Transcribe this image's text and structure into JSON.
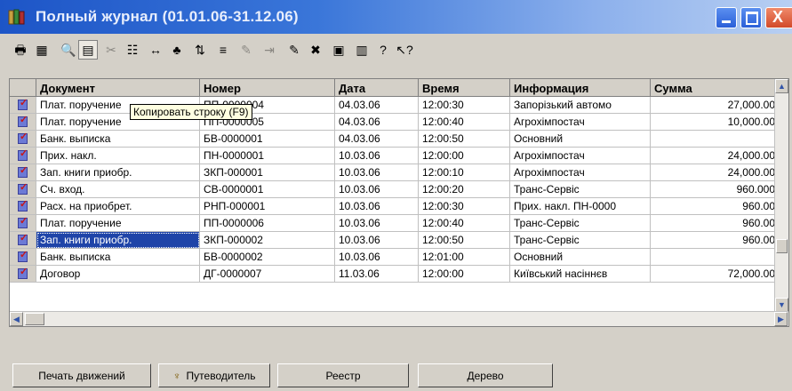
{
  "window": {
    "title": "Полный журнал (01.01.06-31.12.06)",
    "close_glyph": "X"
  },
  "toolbar": {
    "icons": [
      "print-icon",
      "new-doc-icon",
      "find-icon",
      "copy-row-icon",
      "cut-icon",
      "filter-icon",
      "interval-icon",
      "tree-icon",
      "sort-icon",
      "move-icon",
      "disabled-icon",
      "disabled-icon",
      "edit-icon",
      "delete-icon",
      "post-icon",
      "unpost-icon",
      "help-icon",
      "help-context-icon"
    ]
  },
  "tooltip": "Копировать строку (F9)",
  "table": {
    "columns": [
      "Документ",
      "Номер",
      "Дата",
      "Время",
      "Информация",
      "Сумма"
    ],
    "rows": [
      [
        "Плат. поручение",
        "ПП-0000004",
        "04.03.06",
        "12:00:30",
        "Запорізький автомо",
        "27,000.00"
      ],
      [
        "Плат. поручение",
        "ПП-0000005",
        "04.03.06",
        "12:00:40",
        "Агрохімпостач",
        "10,000.00"
      ],
      [
        "Банк. выписка",
        "БВ-0000001",
        "04.03.06",
        "12:00:50",
        "Основний",
        ""
      ],
      [
        "Прих. накл.",
        "ПН-0000001",
        "10.03.06",
        "12:00:00",
        "Агрохімпостач",
        "24,000.00"
      ],
      [
        "Зап. книги приобр.",
        "ЗКП-000001",
        "10.03.06",
        "12:00:10",
        "Агрохімпостач",
        "24,000.00"
      ],
      [
        "Сч. вход.",
        "СВ-0000001",
        "10.03.06",
        "12:00:20",
        "Транс-Сервіс",
        "960.000"
      ],
      [
        "Расх. на приобрет.",
        "РНП-000001",
        "10.03.06",
        "12:00:30",
        "Прих. накл. ПН-0000",
        "960.00"
      ],
      [
        "Плат. поручение",
        "ПП-0000006",
        "10.03.06",
        "12:00:40",
        "Транс-Сервіс",
        "960.00"
      ],
      [
        "Зап. книги приобр.",
        "ЗКП-000002",
        "10.03.06",
        "12:00:50",
        "Транс-Сервіс",
        "960.00"
      ],
      [
        "Банк. выписка",
        "БВ-0000002",
        "10.03.06",
        "12:01:00",
        "Основний",
        ""
      ],
      [
        "Договор",
        "ДГ-0000007",
        "11.03.06",
        "12:00:00",
        "Київський насіннєв",
        "72,000.00"
      ]
    ],
    "selected_row": 8
  },
  "buttons": {
    "print_moves": "Печать движений",
    "guide": "Путеводитель",
    "registry": "Реестр",
    "tree": "Дерево"
  },
  "colors": {
    "selection": "#1f44a8",
    "title_start": "#1d55c7",
    "tooltip_bg": "#ffffe1"
  }
}
